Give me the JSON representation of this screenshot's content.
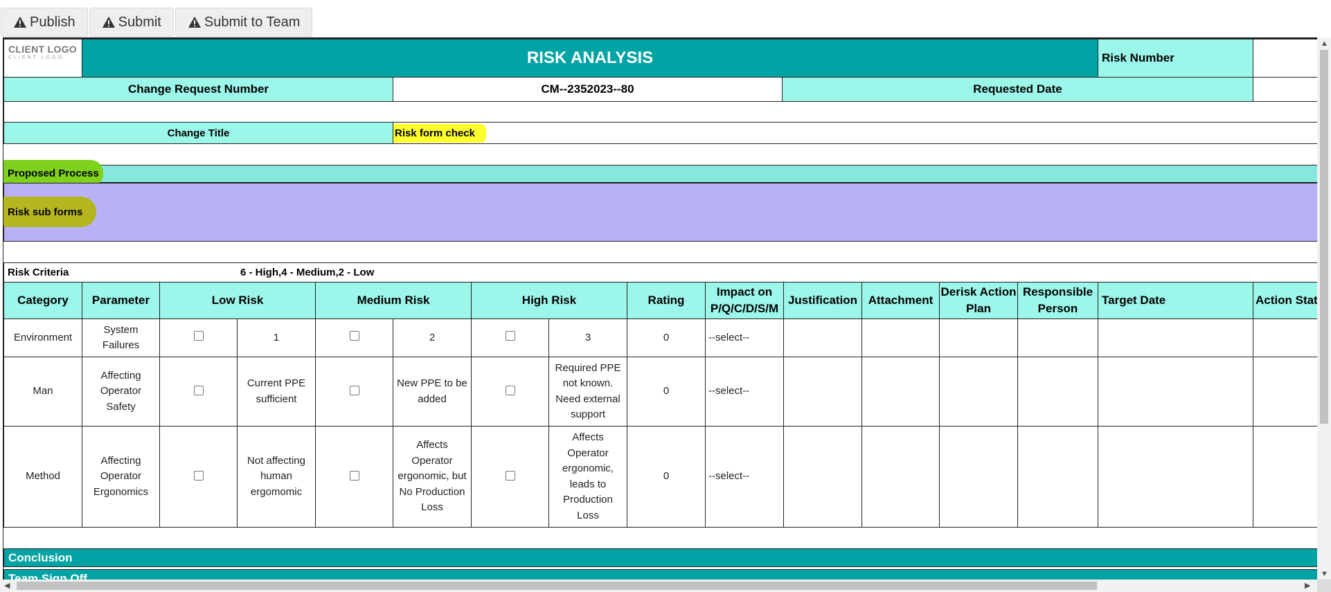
{
  "toolbar": {
    "buttons": [
      {
        "label": "Publish",
        "icon": "warning-icon"
      },
      {
        "label": "Submit",
        "icon": "warning-icon"
      },
      {
        "label": "Submit to Team",
        "icon": "warning-icon"
      }
    ]
  },
  "header": {
    "logo_line1": "CLIENT LOGO",
    "logo_line2": "CLIENT LOGO",
    "title": "RISK ANALYSIS",
    "risk_number_label": "Risk Number",
    "risk_number_value": ""
  },
  "request_row": {
    "crn_label": "Change Request Number",
    "crn_value": "CM--2352023--80",
    "requested_date_label": "Requested Date",
    "requested_date_value": ""
  },
  "change_title": {
    "label": "Change Title",
    "value": "Risk form check"
  },
  "sections": {
    "proposed_process": "Proposed Process",
    "risk_sub_forms": "Risk sub forms",
    "conclusion": "Conclusion",
    "team_sign_off": "Team Sign Off"
  },
  "risk_criteria": {
    "label": "Risk Criteria",
    "value": "6 - High,4 - Medium,2 - Low"
  },
  "table": {
    "headers": {
      "category": "Category",
      "parameter": "Parameter",
      "low_risk": "Low Risk",
      "medium_risk": "Medium Risk",
      "high_risk": "High Risk",
      "rating": "Rating",
      "impact": "Impact on P/Q/C/D/S/M",
      "justification": "Justification",
      "attachment": "Attachment",
      "derisk_action_plan": "Derisk Action Plan",
      "responsible_person": "Responsible Person",
      "target_date": "Target Date",
      "action_status": "Action Status"
    },
    "rows": [
      {
        "category": "Environment",
        "parameter": "System Failures",
        "low": "1",
        "medium": "2",
        "high": "3",
        "rating": "0",
        "impact": "--select--"
      },
      {
        "category": "Man",
        "parameter": "Affecting Operator Safety",
        "low": "Current PPE sufficient",
        "medium": "New PPE to be added",
        "high": "Required PPE not known. Need external support",
        "rating": "0",
        "impact": "--select--"
      },
      {
        "category": "Method",
        "parameter": "Affecting Operator Ergonomics",
        "low": "Not affecting human ergomomic",
        "medium": "Affects Operator ergonomic, but No Production Loss",
        "high": "Affects Operator ergonomic, leads to Production Loss",
        "rating": "0",
        "impact": "--select--"
      }
    ]
  },
  "colors": {
    "teal": "#02a3a5",
    "aqua": "#9cf6ea",
    "lavender": "#b8b1f6",
    "highlight_yellow": "#ffff2e",
    "highlight_olive": "#b5b51f",
    "highlight_green": "#7fd11b"
  }
}
